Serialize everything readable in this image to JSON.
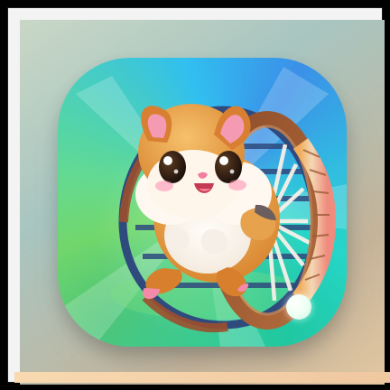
{
  "app_icon": {
    "icon_name": "hamster-wheel-icon",
    "subject": "hamster",
    "accessory": "running wheel",
    "colors": {
      "tile_teal": "#25d6c9",
      "tile_blue": "#3b90e8",
      "tile_green": "#4bd58f",
      "hamster_orange": "#e89b33",
      "hamster_cream": "#fff3e5",
      "wheel_rim": "#a35a31",
      "wheel_bars": "#2e4f84",
      "status_dot": "#ecfff3"
    }
  }
}
